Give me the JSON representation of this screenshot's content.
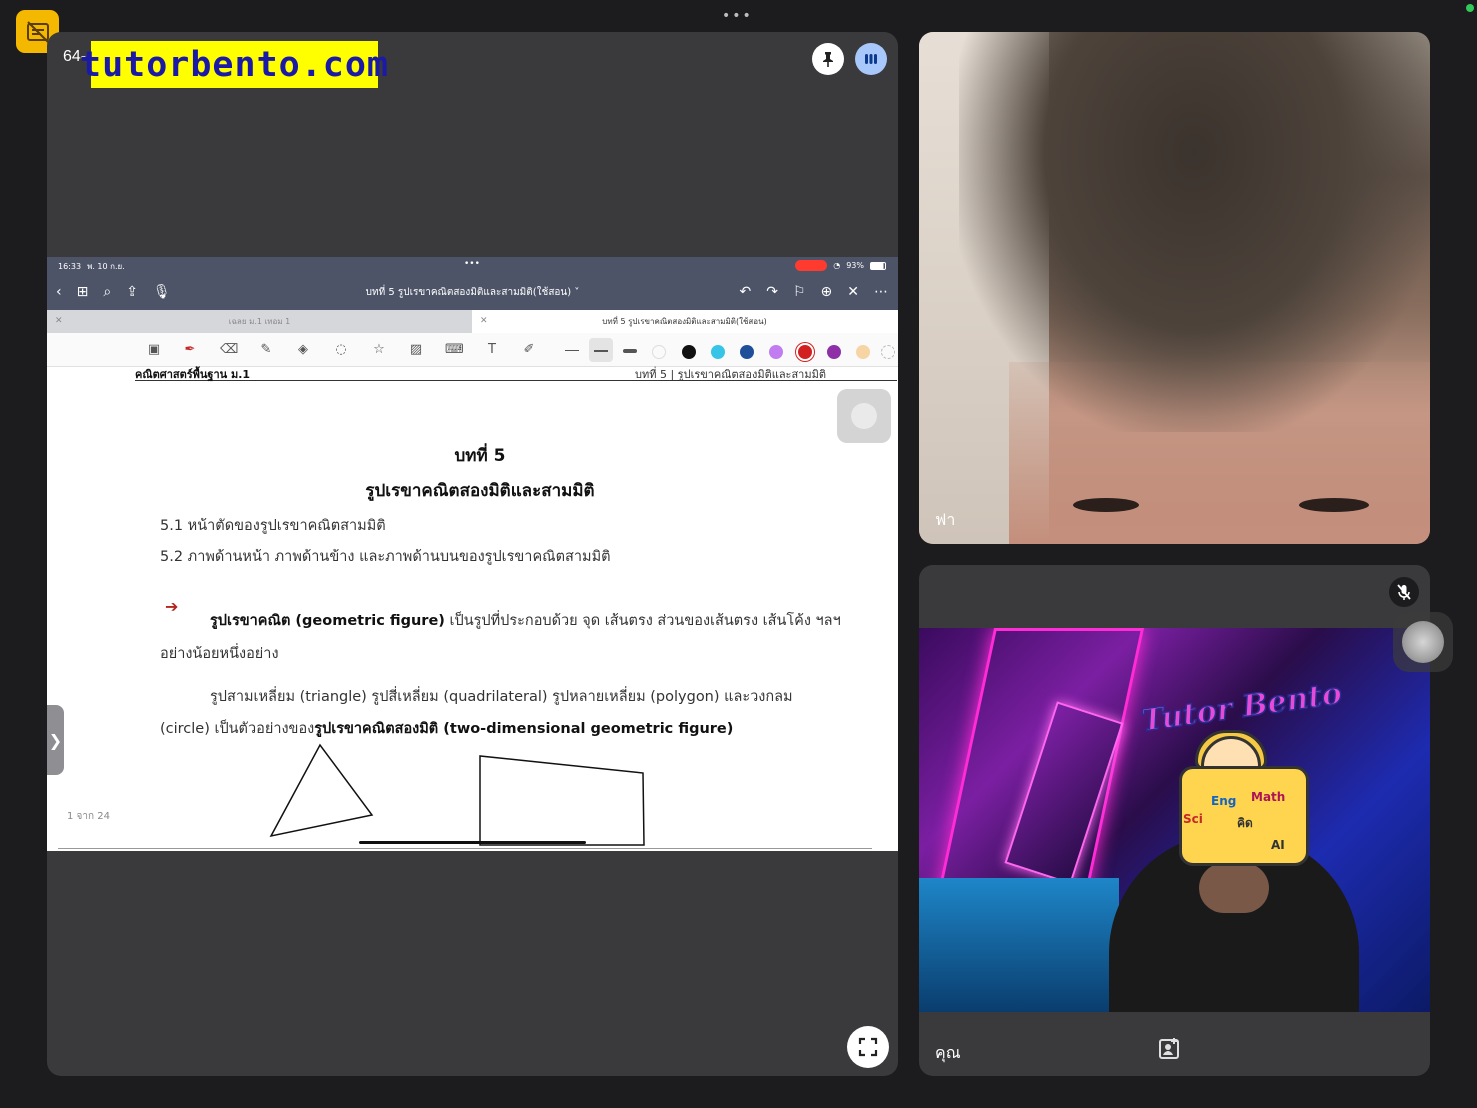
{
  "top_bar": {
    "dots": "•••"
  },
  "main_tile": {
    "name_prefix": "64-",
    "watermark": "tutorbento.com",
    "fullscreen_icon": "fullscreen-icon",
    "pin_icon": "pin-icon",
    "bars_icon": "audio-bars-icon"
  },
  "ipad": {
    "time": "16:33",
    "date": "พ. 10 ก.ย.",
    "battery": "93%",
    "doc_title": "บทที่ 5 รูปเรขาคณิตสองมิติและสามมิติ(ใช้สอน) ˅",
    "tabs": [
      {
        "label": "เฉลย ม.1 เทอม 1",
        "active": false
      },
      {
        "label": "บทที่ 5 รูปเรขาคณิตสองมิติและสามมิติ(ใช้สอน)",
        "active": true
      }
    ],
    "swatches": [
      "#ffffff",
      "#111111",
      "#37c4e6",
      "#1f4e9a",
      "#c07cf0",
      "#d21f1f",
      "#8e2fa8",
      "#f6d4a4"
    ]
  },
  "page": {
    "header_left": "คณิตศาสตร์พื้นฐาน ม.1",
    "header_right": "บทที่ 5  |  รูปเรขาคณิตสองมิติและสามมิติ",
    "chapter": "บทที่ 5",
    "chapter_title": "รูปเรขาคณิตสองมิติและสามมิติ",
    "items": [
      "5.1 หน้าตัดของรูปเรขาคณิตสามมิติ",
      "5.2 ภาพด้านหน้า ภาพด้านข้าง และภาพด้านบนของรูปเรขาคณิตสามมิติ"
    ],
    "def_bold": "รูปเรขาคณิต (geometric figure)",
    "def_rest": " เป็นรูปที่ประกอบด้วย จุด เส้นตรง ส่วนของเส้นตรง เส้นโค้ง ฯลฯ",
    "def_line2": "อย่างน้อยหนึ่งอย่าง",
    "ex_line1": "รูปสามเหลี่ยม (triangle) รูปสี่เหลี่ยม (quadrilateral) รูปหลายเหลี่ยม (polygon) และวงกลม",
    "ex_line2_a": "(circle) เป็นตัวอย่างของ",
    "ex_line2_bold": "รูปเรขาคณิตสองมิติ (two-dimensional geometric figure)",
    "page_indicator": "1 จาก 24",
    "side_chevron": "❯"
  },
  "participants": [
    {
      "name": "ฟา"
    },
    {
      "name": "คุณ",
      "muted": true
    }
  ],
  "sticker": {
    "title": "Tutor Bento",
    "labels": [
      "Sci",
      "Eng",
      "Math",
      "คิด",
      "AI"
    ]
  }
}
